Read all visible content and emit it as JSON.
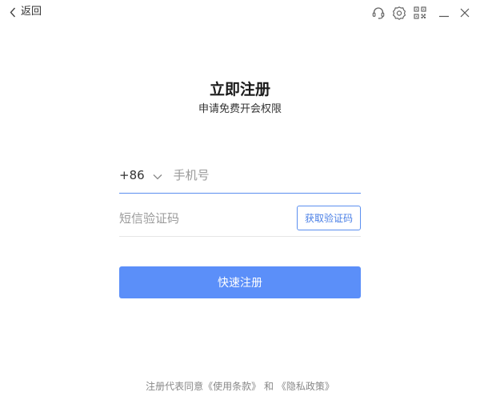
{
  "topbar": {
    "back_label": "返回",
    "back_icon": "chevron-left-icon",
    "controls": [
      "headset-icon",
      "gear-icon",
      "qr-code-icon",
      "minimize-icon",
      "close-icon"
    ]
  },
  "header": {
    "title": "立即注册",
    "subtitle": "申请免费开会权限"
  },
  "form": {
    "country_code": "+86",
    "phone_placeholder": "手机号",
    "code_placeholder": "短信验证码",
    "get_code_label": "获取验证码",
    "submit_label": "快速注册"
  },
  "footer": {
    "prefix": "注册代表同意",
    "terms_link": "《使用条款》",
    "conjunction": "和",
    "privacy_link": "《隐私政策》"
  },
  "colors": {
    "accent": "#5b8ff9",
    "button_text": "#ffffff",
    "muted_text": "#888888"
  }
}
